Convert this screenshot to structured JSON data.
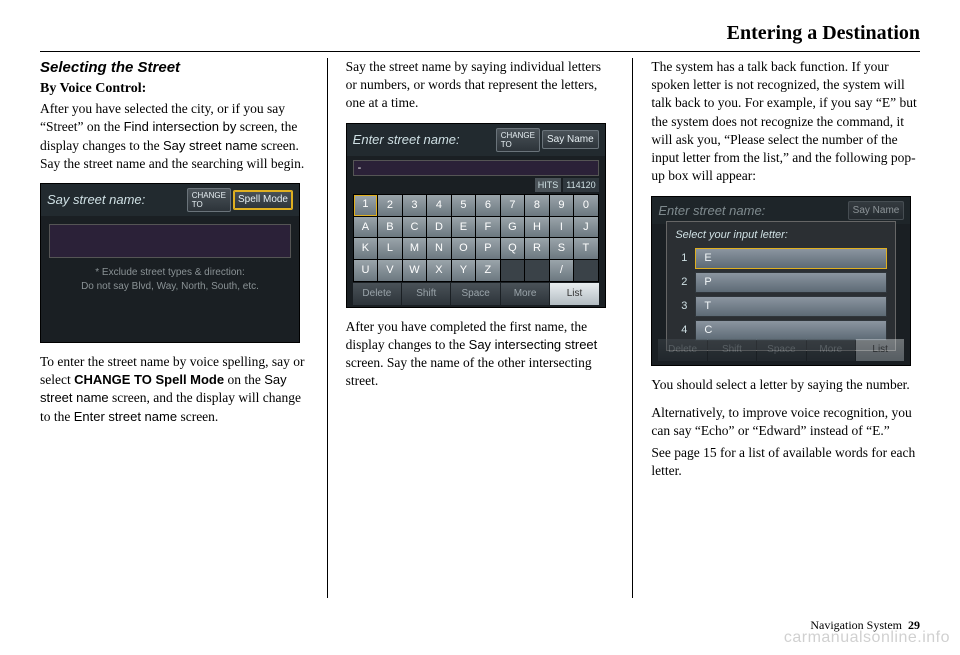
{
  "chapter": "Entering a Destination",
  "section_title": "Selecting the Street",
  "subhead": "By Voice Control:",
  "col1": {
    "p1_a": "After you have selected the city, or if you say “Street” on the ",
    "p1_b": "Find intersection by",
    "p1_c": " screen, the display changes to the ",
    "p1_d": "Say street name",
    "p1_e": " screen. Say the street name and the searching will begin.",
    "shot1": {
      "title": "Say street name:",
      "change_small": "CHANGE\nTO",
      "change_btn": "Spell Mode",
      "hint1": "* Exclude street types & direction:",
      "hint2": "Do not say Blvd, Way, North, South, etc."
    },
    "p2_a": "To enter the street name by voice spelling, say or select ",
    "p2_b": "CHANGE TO Spell Mode",
    "p2_c": " on the ",
    "p2_d": "Say street name",
    "p2_e": " screen, and the display will change to the ",
    "p2_f": "Enter street name",
    "p2_g": " screen."
  },
  "col2": {
    "p1": "Say the street name by saying individual letters or numbers, or words that represent the letters, one at a time.",
    "shot2": {
      "title": "Enter street name:",
      "change_small": "CHANGE\nTO",
      "change_btn": "Say Name",
      "hits_label": "HITS",
      "hits_value": "114120",
      "keys_row1": [
        "1",
        "2",
        "3",
        "4",
        "5",
        "6",
        "7",
        "8",
        "9",
        "0"
      ],
      "keys_row2": [
        "A",
        "B",
        "C",
        "D",
        "E",
        "F",
        "G",
        "H",
        "I",
        "J"
      ],
      "keys_row3": [
        "K",
        "L",
        "M",
        "N",
        "O",
        "P",
        "Q",
        "R",
        "S",
        "T"
      ],
      "keys_row4": [
        "U",
        "V",
        "W",
        "X",
        "Y",
        "Z",
        "",
        "",
        "/",
        ""
      ],
      "extra_col": [
        "-",
        "'",
        "&",
        ""
      ],
      "bottom": [
        "Delete",
        "Shift",
        "Space",
        "More",
        "List"
      ]
    },
    "p2_a": "After you have completed the first name, the display changes to the ",
    "p2_b": "Say intersecting street",
    "p2_c": " screen. Say the name of the other intersecting street."
  },
  "col3": {
    "p1": "The system has a talk back function. If your spoken letter is not recognized, the system will talk back to you. For example, if you say “E” but the system does not recognize the command, it will ask you, “Please select the number of the input letter from the list,” and the following pop-up box will appear:",
    "shot3": {
      "bg_title": "Enter street name:",
      "bg_btn": "Say Name",
      "popup_title": "Select your input letter:",
      "rows": [
        {
          "n": "1",
          "v": "E"
        },
        {
          "n": "2",
          "v": "P"
        },
        {
          "n": "3",
          "v": "T"
        },
        {
          "n": "4",
          "v": "C"
        }
      ],
      "bottom": [
        "Delete",
        "Shift",
        "Space",
        "More",
        "List"
      ]
    },
    "p2": "You should select a letter by saying the number.",
    "p3": "Alternatively, to improve voice recognition, you can say “Echo” or “Edward” instead of “E.”",
    "p4": "See page 15 for a list of available words for each letter."
  },
  "footer_label": "Navigation System",
  "footer_page": "29",
  "watermark": "carmanualsonline.info"
}
